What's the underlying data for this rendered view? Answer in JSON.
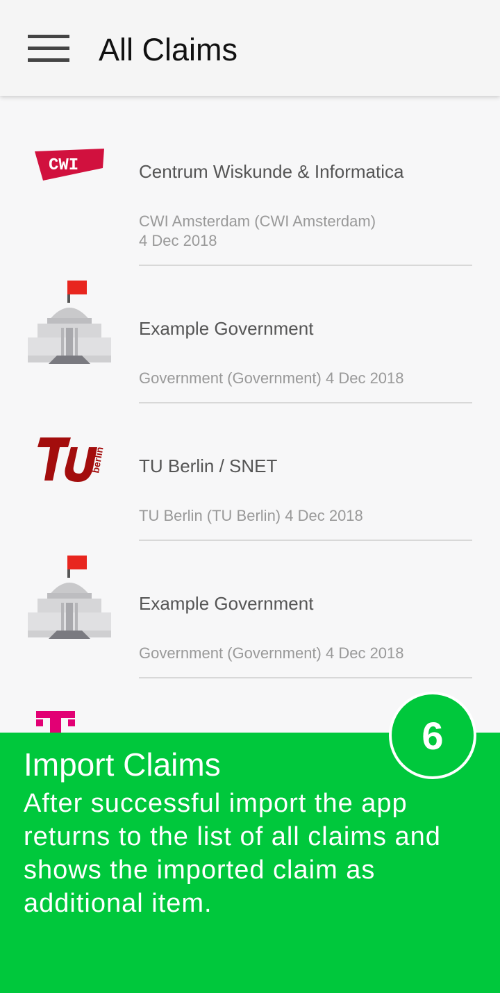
{
  "appbar": {
    "title": "All Claims",
    "menu_icon": "hamburger-menu-icon"
  },
  "claims": [
    {
      "title": "Centrum Wiskunde & Informatica",
      "subtitle_line1": "CWI Amsterdam (CWI Amsterdam)",
      "subtitle_line2": "4 Dec 2018",
      "logo": "cwi-logo",
      "logo_text": "CWI",
      "logo_color": "#d1113e"
    },
    {
      "title": "Example Government",
      "subtitle": "Government (Government) 4 Dec 2018",
      "logo": "government-building-icon"
    },
    {
      "title": "TU Berlin / SNET",
      "subtitle": "TU Berlin (TU Berlin) 4 Dec 2018",
      "logo": "tu-berlin-logo",
      "logo_text": "TU",
      "logo_small_text": "berlin",
      "logo_color": "#a30d0d"
    },
    {
      "title": "Example Government",
      "subtitle": "Government (Government) 4 Dec 2018",
      "logo": "government-building-icon"
    },
    {
      "logo": "telekom-logo",
      "logo_text": "T",
      "logo_color": "#e20074"
    }
  ],
  "overlay": {
    "step": "6",
    "title": "Import Claims",
    "body": "After successful import the app returns to the list of all claims and shows the imported claim as additional item.",
    "color": "#00c83c"
  }
}
